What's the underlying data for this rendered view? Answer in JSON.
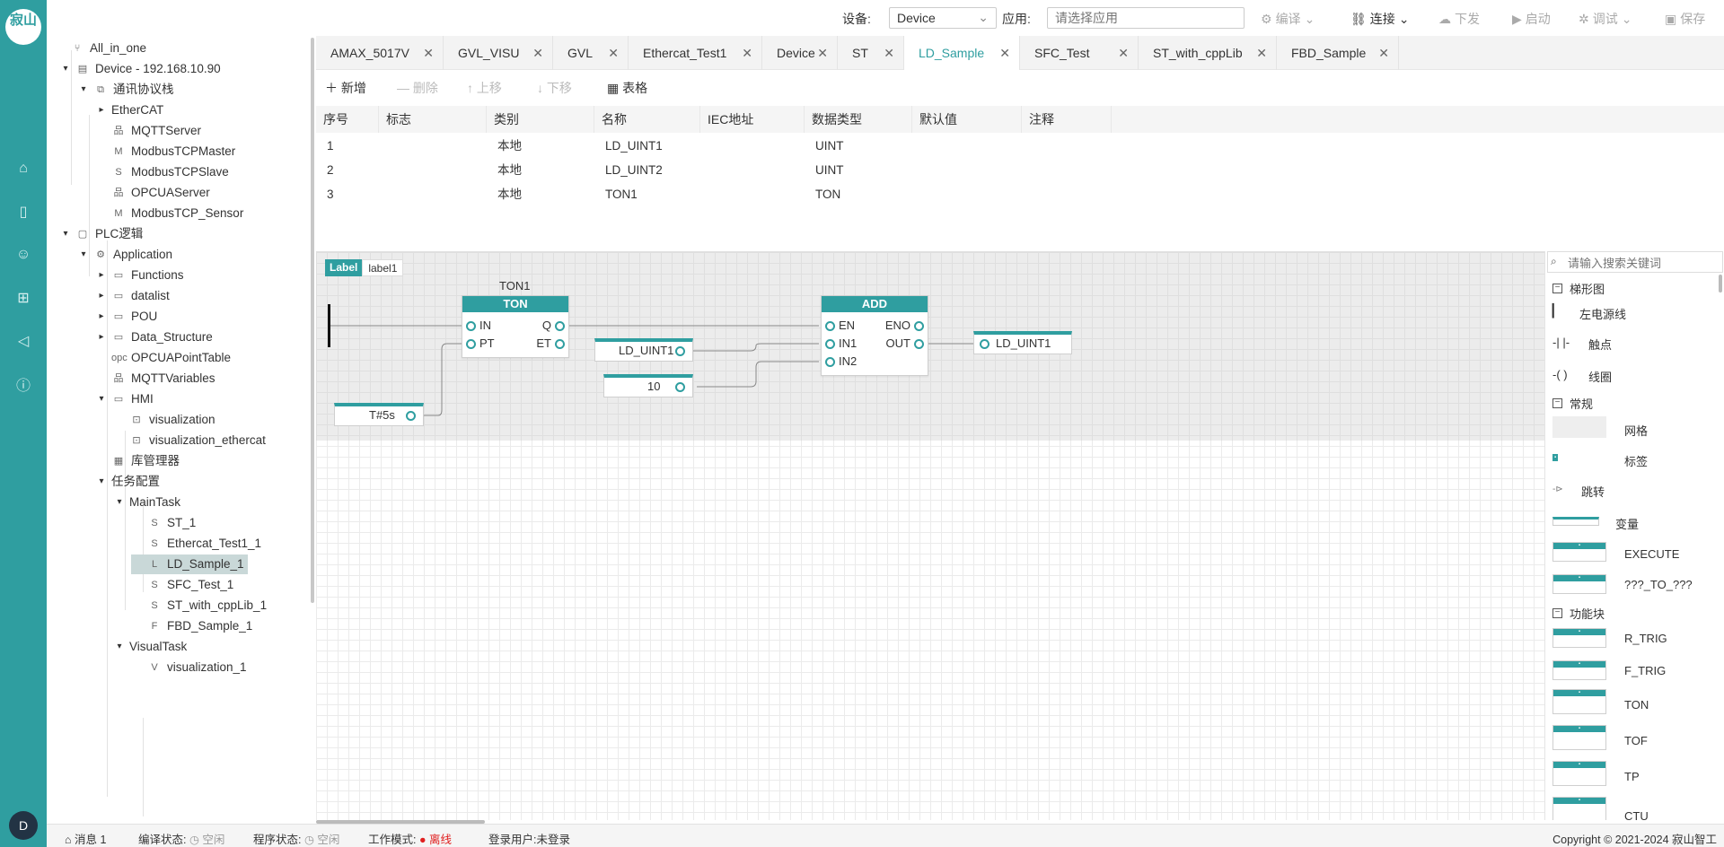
{
  "rail": {
    "logo_text": "寂山",
    "icons": [
      "home-icon",
      "book-icon",
      "users-icon",
      "org-icon",
      "megaphone-icon",
      "help-icon"
    ],
    "avatar": "D"
  },
  "topbar": {
    "device_label": "设备:",
    "device_value": "Device",
    "app_label": "应用:",
    "app_placeholder": "请选择应用",
    "compile": "编译",
    "connect": "连接",
    "download": "下发",
    "start": "启动",
    "debug": "调试",
    "save": "保存"
  },
  "tree": {
    "nodes": [
      {
        "label": "All_in_one",
        "icon": "⑂",
        "caret": "",
        "indent": 0
      },
      {
        "label": "Device - 192.168.10.90",
        "icon": "▤",
        "caret": "▾",
        "indent": 1
      },
      {
        "label": "通讯协议栈",
        "icon": "⧉",
        "caret": "▾",
        "indent": 2
      },
      {
        "label": "EtherCAT",
        "icon": "",
        "caret": "▸",
        "indent": 3
      },
      {
        "label": "MQTTServer",
        "icon": "品",
        "caret": "",
        "indent": 3
      },
      {
        "label": "ModbusTCPMaster",
        "icon": "M",
        "caret": "",
        "indent": 3
      },
      {
        "label": "ModbusTCPSlave",
        "icon": "S",
        "caret": "",
        "indent": 3
      },
      {
        "label": "OPCUAServer",
        "icon": "品",
        "caret": "",
        "indent": 3
      },
      {
        "label": "ModbusTCP_Sensor",
        "icon": "M",
        "caret": "",
        "indent": 3
      },
      {
        "label": "PLC逻辑",
        "icon": "▢",
        "caret": "▾",
        "indent": 1
      },
      {
        "label": "Application",
        "icon": "⚙",
        "caret": "▾",
        "indent": 2
      },
      {
        "label": "Functions",
        "icon": "▭",
        "caret": "▸",
        "indent": 3
      },
      {
        "label": "datalist",
        "icon": "▭",
        "caret": "▸",
        "indent": 3
      },
      {
        "label": "POU",
        "icon": "▭",
        "caret": "▸",
        "indent": 3
      },
      {
        "label": "Data_Structure",
        "icon": "▭",
        "caret": "▸",
        "indent": 3
      },
      {
        "label": "OPCUAPointTable",
        "icon": "opc",
        "caret": "",
        "indent": 3
      },
      {
        "label": "MQTTVariables",
        "icon": "品",
        "caret": "",
        "indent": 3
      },
      {
        "label": "HMI",
        "icon": "▭",
        "caret": "▾",
        "indent": 3
      },
      {
        "label": "visualization",
        "icon": "⊡",
        "caret": "",
        "indent": 4
      },
      {
        "label": "visualization_ethercat",
        "icon": "⊡",
        "caret": "",
        "indent": 4
      },
      {
        "label": "库管理器",
        "icon": "▦",
        "caret": "",
        "indent": 3
      },
      {
        "label": "任务配置",
        "icon": "",
        "caret": "▾",
        "indent": 3
      },
      {
        "label": "MainTask",
        "icon": "",
        "caret": "▾",
        "indent": 4
      },
      {
        "label": "ST_1",
        "icon": "S",
        "caret": "",
        "indent": 5
      },
      {
        "label": "Ethercat_Test1_1",
        "icon": "S",
        "caret": "",
        "indent": 5
      },
      {
        "label": "LD_Sample_1",
        "icon": "L",
        "caret": "",
        "indent": 5,
        "selected": true
      },
      {
        "label": "SFC_Test_1",
        "icon": "S",
        "caret": "",
        "indent": 5
      },
      {
        "label": "ST_with_cppLib_1",
        "icon": "S",
        "caret": "",
        "indent": 5
      },
      {
        "label": "FBD_Sample_1",
        "icon": "F",
        "caret": "",
        "indent": 5
      },
      {
        "label": "VisualTask",
        "icon": "",
        "caret": "▾",
        "indent": 4
      },
      {
        "label": "visualization_1",
        "icon": "V",
        "caret": "",
        "indent": 5
      }
    ]
  },
  "tabs": [
    "AMAX_5017V",
    "GVL_VISU",
    "GVL",
    "Ethercat_Test1",
    "Device",
    "ST",
    "LD_Sample",
    "SFC_Test",
    "ST_with_cppLib",
    "FBD_Sample"
  ],
  "active_tab": "LD_Sample",
  "var_toolbar": {
    "add": "新增",
    "delete": "删除",
    "up": "上移",
    "down": "下移",
    "table": "表格"
  },
  "var_table": {
    "headers": [
      "序号",
      "标志",
      "类别",
      "名称",
      "IEC地址",
      "数据类型",
      "默认值",
      "注释"
    ],
    "rows": [
      [
        "1",
        "",
        "本地",
        "LD_UINT1",
        "",
        "UINT",
        "",
        ""
      ],
      [
        "2",
        "",
        "本地",
        "LD_UINT2",
        "",
        "UINT",
        "",
        ""
      ],
      [
        "3",
        "",
        "本地",
        "TON1",
        "",
        "TON",
        "",
        ""
      ]
    ]
  },
  "diagram": {
    "label_tag": "Label",
    "label_value": "label1",
    "ton_instance": "TON1",
    "ton_title": "TON",
    "ton_in": "IN",
    "ton_pt": "PT",
    "ton_q": "Q",
    "ton_et": "ET",
    "pt_value": "T#5s",
    "add_title": "ADD",
    "add_en": "EN",
    "add_in1": "IN1",
    "add_in2": "IN2",
    "add_eno": "ENO",
    "add_out": "OUT",
    "in1_var": "LD_UINT1",
    "in2_const": "10",
    "out_var": "LD_UINT1"
  },
  "palette": {
    "search_placeholder": "请输入搜索关键词",
    "group_ladder": "梯形图",
    "left_rail": "左电源线",
    "contact": "触点",
    "coil": "线圈",
    "group_common": "常规",
    "grid": "网格",
    "label": "标签",
    "jump": "跳转",
    "variable": "变量",
    "execute": "EXECUTE",
    "convert": "???_TO_???",
    "group_fb": "功能块",
    "r_trig": "R_TRIG",
    "f_trig": "F_TRIG",
    "ton": "TON",
    "tof": "TOF",
    "tp": "TP",
    "ctu": "CTU"
  },
  "status": {
    "messages": "消息 1",
    "compile_state_label": "编译状态:",
    "compile_state": "空闲",
    "program_state_label": "程序状态:",
    "program_state": "空闲",
    "work_mode_label": "工作模式:",
    "work_mode": "离线",
    "login_label": "登录用户:",
    "login_user": "未登录",
    "copyright": "Copyright © 2021-2024 寂山智工"
  },
  "colors": {
    "accent": "#2f9ea0",
    "offline": "#e02020"
  }
}
